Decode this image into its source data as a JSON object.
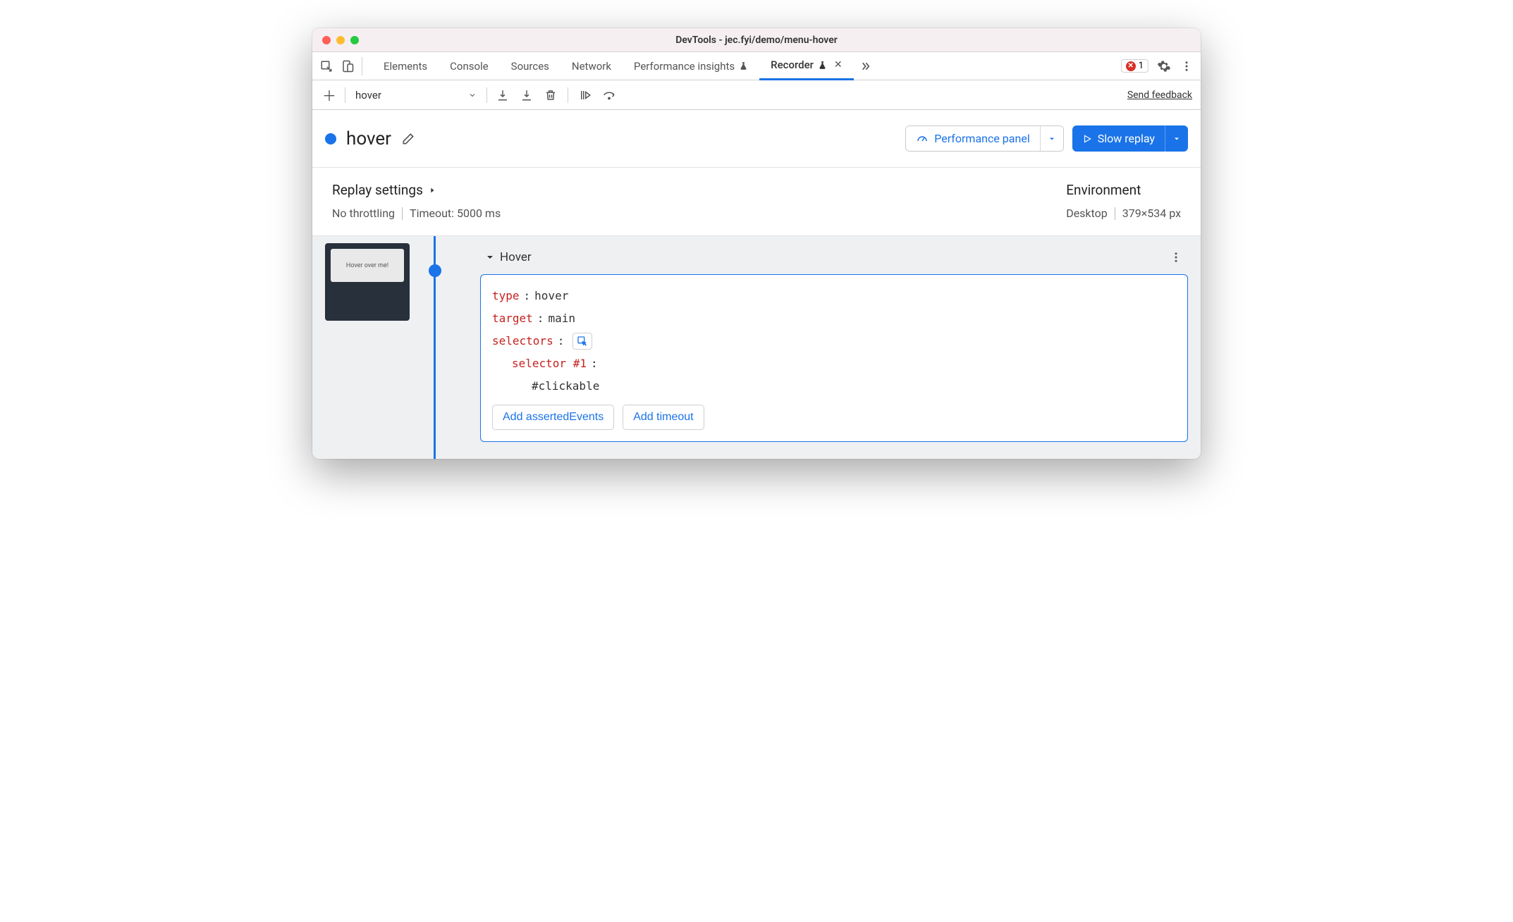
{
  "window": {
    "title": "DevTools - jec.fyi/demo/menu-hover"
  },
  "tabs": {
    "items": [
      {
        "label": "Elements"
      },
      {
        "label": "Console"
      },
      {
        "label": "Sources"
      },
      {
        "label": "Network"
      },
      {
        "label": "Performance insights",
        "beta": true
      },
      {
        "label": "Recorder",
        "beta": true,
        "active": true,
        "closable": true
      }
    ],
    "errors": "1"
  },
  "toolbar": {
    "recording_selected": "hover",
    "feedback": "Send feedback"
  },
  "header": {
    "recording_name": "hover",
    "perf_panel": "Performance panel",
    "slow_replay": "Slow replay"
  },
  "settings": {
    "replay_heading": "Replay settings",
    "throttling": "No throttling",
    "timeout": "Timeout: 5000 ms",
    "env_heading": "Environment",
    "device": "Desktop",
    "dimensions": "379×534 px"
  },
  "thumbnail": {
    "text": "Hover over me!"
  },
  "step": {
    "title": "Hover",
    "type_key": "type",
    "type_val": "hover",
    "target_key": "target",
    "target_val": "main",
    "selectors_key": "selectors",
    "selector1_key": "selector #1",
    "selector1_val": "#clickable",
    "add_asserted": "Add assertedEvents",
    "add_timeout": "Add timeout"
  }
}
